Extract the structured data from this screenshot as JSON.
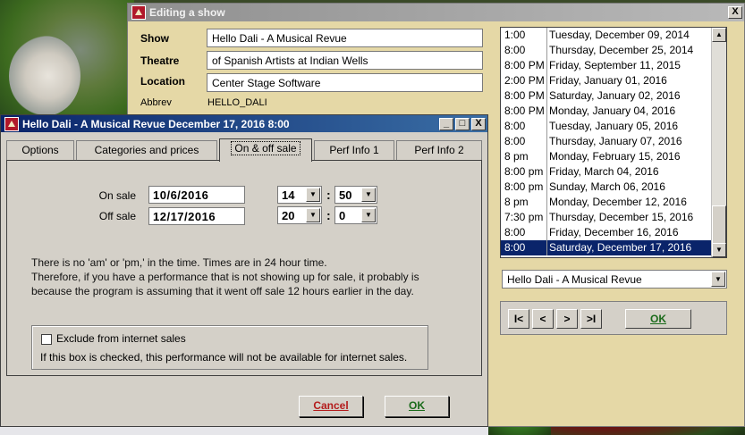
{
  "edit_show_window": {
    "title": "Editing a show",
    "close_glyph": "X",
    "fields": {
      "show": {
        "label": "Show",
        "value": "Hello Dali - A Musical Revue"
      },
      "theatre": {
        "label": "Theatre",
        "value": "of Spanish Artists at Indian Wells"
      },
      "location": {
        "label": "Location",
        "value": "Center Stage Software"
      },
      "abbrev": {
        "label": "Abbrev",
        "value": "HELLO_DALI"
      }
    },
    "performances": [
      {
        "time": "1:00",
        "date": "Tuesday, December 09, 2014"
      },
      {
        "time": "8:00",
        "date": "Thursday, December 25, 2014"
      },
      {
        "time": "8:00 PM",
        "date": "Friday, September 11, 2015"
      },
      {
        "time": "2:00 PM",
        "date": "Friday, January 01, 2016"
      },
      {
        "time": "8:00 PM",
        "date": "Saturday, January 02, 2016"
      },
      {
        "time": "8:00 PM",
        "date": "Monday, January 04, 2016"
      },
      {
        "time": "8:00",
        "date": "Tuesday, January 05, 2016"
      },
      {
        "time": "8:00",
        "date": "Thursday, January 07, 2016"
      },
      {
        "time": "8 pm",
        "date": "Monday, February 15, 2016"
      },
      {
        "time": "8:00 pm",
        "date": "Friday, March 04, 2016"
      },
      {
        "time": "8:00 pm",
        "date": "Sunday, March 06, 2016"
      },
      {
        "time": "8 pm",
        "date": "Monday, December 12, 2016"
      },
      {
        "time": "7:30 pm",
        "date": "Thursday, December 15, 2016"
      },
      {
        "time": "8:00",
        "date": "Friday, December 16, 2016"
      },
      {
        "time": "8:00",
        "date": "Saturday, December 17, 2016",
        "selected": true
      }
    ],
    "show_selector": "Hello Dali - A Musical Revue",
    "nav": {
      "first": "I<",
      "prev": "<",
      "next": ">",
      "last": ">I",
      "ok": "OK"
    }
  },
  "perf_window": {
    "title": "Hello Dali - A Musical Revue December 17, 2016 8:00",
    "controls": {
      "minimize": "_",
      "maximize": "□",
      "close": "X"
    },
    "tabs": [
      "Options",
      "Categories and prices",
      "On & off sale",
      "Perf Info 1",
      "Perf Info 2"
    ],
    "active_tab": "On & off sale",
    "on_sale": {
      "label": "On sale",
      "date": "10/6/2016",
      "hour": "14",
      "minute": "50"
    },
    "off_sale": {
      "label": "Off sale",
      "date": "12/17/2016",
      "hour": "20",
      "minute": "0"
    },
    "note_lines": [
      "There is no 'am' or 'pm,' in the time. Times are in 24 hour time.",
      "Therefore, if you have a performance that is not showing up for sale, it probably is",
      "because the program is assuming that it went off sale 12 hours earlier in the day."
    ],
    "exclude_checkbox": {
      "label": "Exclude from internet sales",
      "checked": false
    },
    "exclude_help": "If this box is checked, this performance will not be available for internet sales.",
    "cancel_label": "Cancel",
    "ok_label": "OK"
  }
}
